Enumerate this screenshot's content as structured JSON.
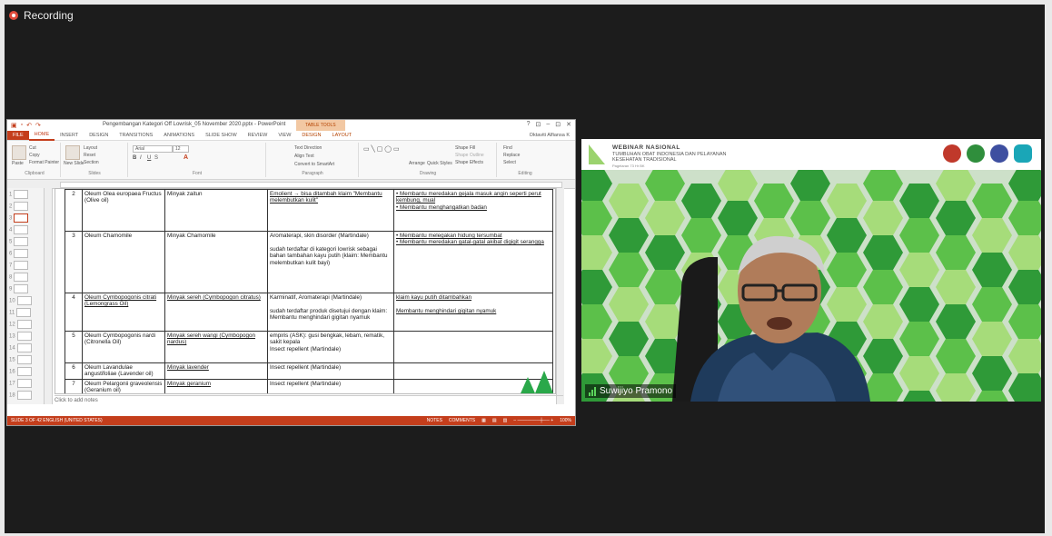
{
  "recording": {
    "label": "Recording"
  },
  "ppt": {
    "title": "Pengembangan Kategori Off Lowrisk_05 November 2020.pptx - PowerPoint",
    "context_tab": "TABLE TOOLS",
    "window_controls": [
      "?",
      "⊡",
      "–",
      "⊡",
      "✕"
    ],
    "tabs": [
      "FILE",
      "HOME",
      "INSERT",
      "DESIGN",
      "TRANSITIONS",
      "ANIMATIONS",
      "SLIDE SHOW",
      "REVIEW",
      "VIEW",
      "DESIGN",
      "LAYOUT"
    ],
    "user": "Oktaviti Alfiansa K",
    "ribbon": {
      "clipboard": {
        "paste": "Paste",
        "cut": "Cut",
        "copy": "Copy",
        "painter": "Format Painter",
        "cap": "Clipboard"
      },
      "slides": {
        "new": "New Slide",
        "layout": "Layout",
        "reset": "Reset",
        "section": "Section",
        "cap": "Slides"
      },
      "font": {
        "name": "Arial",
        "size": "12",
        "cap": "Font"
      },
      "paragraph": {
        "dir": "Text Direction",
        "align": "Align Text",
        "smart": "Convert to SmartArt",
        "cap": "Paragraph"
      },
      "drawing": {
        "arrange": "Arrange",
        "quick": "Quick Styles",
        "fill": "Shape Fill",
        "outline": "Shape Outline",
        "effects": "Shape Effects",
        "cap": "Drawing"
      },
      "editing": {
        "find": "Find",
        "replace": "Replace",
        "select": "Select",
        "cap": "Editing"
      }
    },
    "thumbnails": [
      "1",
      "2",
      "3",
      "4",
      "5",
      "6",
      "7",
      "8",
      "9",
      "10",
      "11",
      "12",
      "13",
      "14",
      "15",
      "16",
      "17",
      "18"
    ],
    "notes_placeholder": "Click to add notes",
    "status_left": "SLIDE 3 OF 42    ENGLISH (UNITED STATES)",
    "status_right": [
      "NOTES",
      "COMMENTS",
      "100%"
    ],
    "table": {
      "rows": [
        {
          "no": "2",
          "latin": "Oleum Olea europaea Fructus (Olive oil)",
          "name": "Minyak zaitun",
          "indication": "Emolient → bisa ditambah klaim \"Membantu melembutkan kulit\"",
          "claim": "• Membantu meredakan gejala masuk angin seperti perut kembung, mual\n• Membantu menghangatkan badan"
        },
        {
          "no": "3",
          "latin": "Oleum Chamomile",
          "name": "Minyak Chamomile",
          "indication": "Aromaterapi, skin disorder (Martindale)\n\nsudah terdaftar di kategori lowrisk sebagai bahan tambahan kayu putih (klaim: Membantu melembutkan kulit bayi)",
          "claim": "• Membantu melegakan hidung tersumbat\n• Membantu meredakan gatal-gatal akibat digigit serangga"
        },
        {
          "no": "4",
          "latin": "Oleum Cymbopogonis citrati (Lemongrass Oil)",
          "name": "Minyak sereh (Cymbopogon citratus)",
          "indication": "Karminatif, Aromaterapi (Martindale)\n\nsudah terdaftar produk disetujui dengan klaim: Membantu menghindari gigitan nyamuk",
          "claim": "klaim kayu putih ditambahkan\n\nMembantu menghindari gigitan nyamuk"
        },
        {
          "no": "5",
          "latin": "Oleum Cymbopogonis nardi (Citronella Oil)",
          "name": "Minyak sereh wangi (Cymbopogon nardus)",
          "indication": "empiris (ASK): gusi bengkak, lebam, rematik, sakit kepala\nInsect repellent (Martindale)",
          "claim": ""
        },
        {
          "no": "6",
          "latin": "Oleum Lavandulae angustifoliae (Lavender oil)",
          "name": "Minyak lavender",
          "indication": "Insect repellent (Martindale)",
          "claim": ""
        },
        {
          "no": "7",
          "latin": "Oleum Pelargonii graveolensis (Geranium oil)",
          "name": "Minyak geranium",
          "indication": "Insect repellent (Martindale)",
          "claim": ""
        }
      ]
    }
  },
  "video": {
    "title": "WEBINAR NASIONAL",
    "subtitle": "TUMBUHAN OBAT INDONESIA DAN PELAYANAN KESEHATAN TRADISIONAL",
    "date_line": "Pagelaran 73 Hr BK",
    "speaker_name": "Suwijiyo Pramono",
    "colors": {
      "hex_dark": "#2f9a38",
      "hex_mid": "#5cc04a",
      "hex_light": "#a6dc7a",
      "hex_pale": "#e3f2d6"
    }
  }
}
